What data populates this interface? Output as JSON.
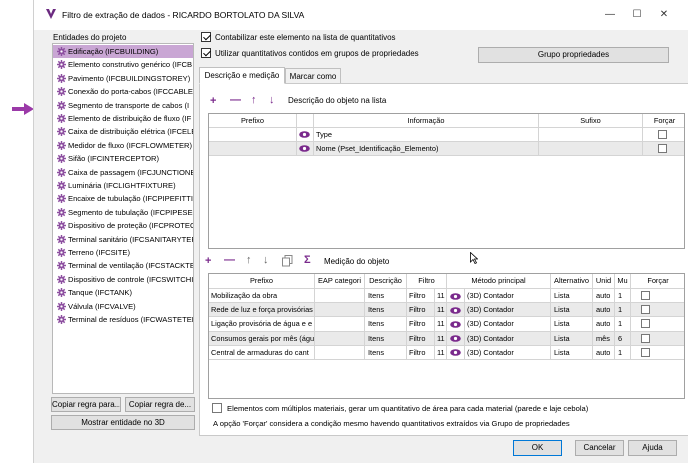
{
  "window": {
    "title": "Filtro de extração de dados - RICARDO BORTOLATO DA SILVA"
  },
  "colors": {
    "accent": "#7a2a8c",
    "selection": "#c9a6d4",
    "arrow": "#9b3aa8"
  },
  "left_panel": {
    "label": "Entidades do projeto",
    "items": [
      "Edificação (IFCBUILDING)",
      "Elemento construtivo genérico (IFCB",
      "Pavimento (IFCBUILDINGSTOREY)",
      "Conexão do porta-cabos (IFCCABLEC",
      "Segmento de transporte de cabos (I",
      "Elemento de distribuição de fluxo (IF",
      "Caixa de distribuição elétrica (IFCELE",
      "Medidor de fluxo (IFCFLOWMETER)",
      "Sifão (IFCINTERCEPTOR)",
      "Caixa de passagem (IFCJUNCTIONBO",
      "Luminária (IFCLIGHTFIXTURE)",
      "Encaixe de tubulação (IFCPIPEFITTIN",
      "Segmento de tubulação (IFCPIPESEG",
      "Dispositivo de proteção (IFCPROTEC",
      "Terminal sanitário (IFCSANITARYTERI",
      "Terreno (IFCSITE)",
      "Terminal de ventilação (IFCSTACKTEF",
      "Dispositivo de controle (IFCSWITCHI",
      "Tanque (IFCTANK)",
      "Válvula (IFCVALVE)",
      "Terminal de resíduos (IFCWASTETERI"
    ],
    "copy_rule_to": "Copiar regra para...",
    "copy_rule_from": "Copiar regra de...",
    "show_3d": "Mostrar entidade no 3D"
  },
  "options": {
    "count_element": "Contabilizar este elemento na lista de quantitativos",
    "use_group_quantities": "Utilizar quantitativos contidos em grupos de propriedades",
    "group_properties_button": "Grupo propriedades"
  },
  "tabs": [
    "Descrição e medição",
    "Marcar como"
  ],
  "description_section": {
    "title": "Descrição do objeto na lista",
    "columns": [
      "Prefixo",
      "Informação",
      "Sufixo",
      "Forçar"
    ],
    "rows": [
      {
        "prefix": "",
        "info": "Type",
        "suffix": ""
      },
      {
        "prefix": "",
        "info": "Nome (Pset_Identificação_Elemento)",
        "suffix": ""
      }
    ]
  },
  "measurement_section": {
    "title": "Medição do objeto",
    "columns": [
      "Prefixo",
      "EAP categori",
      "Descrição",
      "Filtro",
      "Método principal",
      "Alternativo",
      "Unid",
      "Mu",
      "Forçar"
    ],
    "rows": [
      {
        "prefix": "Mobilização da obra",
        "eap": "",
        "desc": "Itens",
        "filter": "Filtro",
        "filter_n": "11",
        "method": "(3D) Contador",
        "alt": "Lista",
        "unit": "auto",
        "mult": "1"
      },
      {
        "prefix": "Rede de luz e força provisórias",
        "eap": "",
        "desc": "Itens",
        "filter": "Filtro",
        "filter_n": "11",
        "method": "(3D) Contador",
        "alt": "Lista",
        "unit": "auto",
        "mult": "1"
      },
      {
        "prefix": "Ligação provisória de água e e",
        "eap": "",
        "desc": "Itens",
        "filter": "Filtro",
        "filter_n": "11",
        "method": "(3D) Contador",
        "alt": "Lista",
        "unit": "auto",
        "mult": "1"
      },
      {
        "prefix": "Consumos gerais por mês (águ",
        "eap": "",
        "desc": "Itens",
        "filter": "Filtro",
        "filter_n": "11",
        "method": "(3D) Contador",
        "alt": "Lista",
        "unit": "mês",
        "mult": "6"
      },
      {
        "prefix": "Central de armaduras do cant",
        "eap": "",
        "desc": "Itens",
        "filter": "Filtro",
        "filter_n": "11",
        "method": "(3D) Contador",
        "alt": "Lista",
        "unit": "auto",
        "mult": "1"
      }
    ]
  },
  "footer": {
    "multi_material": "Elementos com múltiplos materiais, gerar um quantitativo de área para cada material (parede e laje cebola)",
    "force_note": "A opção 'Forçar' considera a condição mesmo havendo quantitativos extraídos via Grupo de propriedades",
    "ok": "OK",
    "cancel": "Cancelar",
    "help": "Ajuda"
  }
}
